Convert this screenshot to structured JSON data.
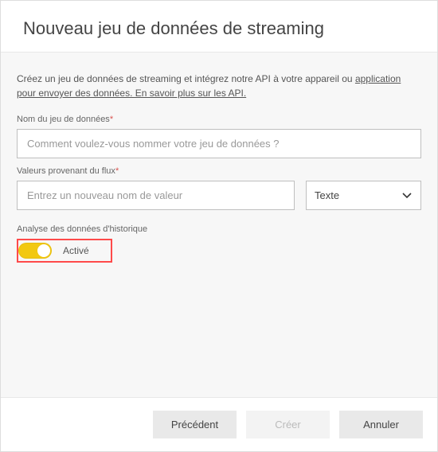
{
  "title": "Nouveau jeu de données de streaming",
  "description": {
    "text1": "Créez un jeu de données de streaming et intégrez notre API à votre appareil ou ",
    "link": "application pour envoyer des données. En savoir plus sur les API.",
    "text2": ""
  },
  "fields": {
    "name": {
      "label": "Nom du jeu de données",
      "required_mark": "*",
      "placeholder": "Comment voulez-vous nommer votre jeu de données ?"
    },
    "values": {
      "label": "Valeurs provenant du flux",
      "required_mark": "*",
      "name_placeholder": "Entrez un nouveau nom de valeur",
      "type_selected": "Texte"
    },
    "history": {
      "label": "Analyse des données d'historique",
      "state_label": "Activé",
      "enabled": true
    }
  },
  "footer": {
    "previous": "Précédent",
    "create": "Créer",
    "cancel": "Annuler"
  }
}
